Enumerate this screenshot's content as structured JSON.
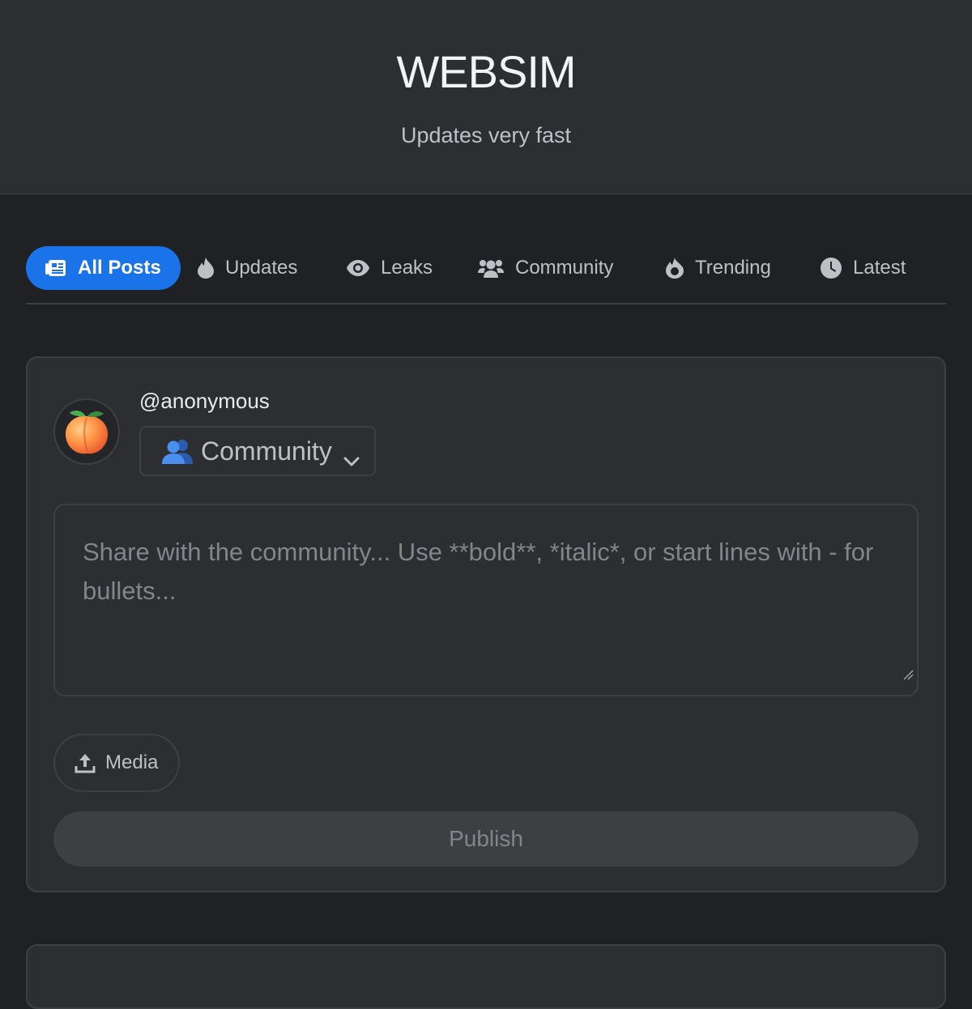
{
  "header": {
    "title": "WEBSIM",
    "subtitle": "Updates very fast"
  },
  "tabs": [
    {
      "label": "All Posts",
      "icon": "newspaper-icon",
      "active": true
    },
    {
      "label": "Updates",
      "icon": "fire-icon",
      "active": false
    },
    {
      "label": "Leaks",
      "icon": "eye-icon",
      "active": false
    },
    {
      "label": "Community",
      "icon": "users-icon",
      "active": false
    },
    {
      "label": "Trending",
      "icon": "flame-icon",
      "active": false
    },
    {
      "label": "Latest",
      "icon": "clock-icon",
      "active": false
    }
  ],
  "composer": {
    "username": "@anonymous",
    "avatar_icon": "peach-icon",
    "category": {
      "selected": "Community",
      "icon": "people-emoji-icon"
    },
    "textarea_placeholder": "Share with the community... Use **bold**, *italic*, or start lines with - for bullets...",
    "media_label": "Media",
    "publish_label": "Publish"
  },
  "colors": {
    "accent": "#1a73e8",
    "background": "#202124",
    "surface": "#2d2e31",
    "border": "#3c4043"
  }
}
